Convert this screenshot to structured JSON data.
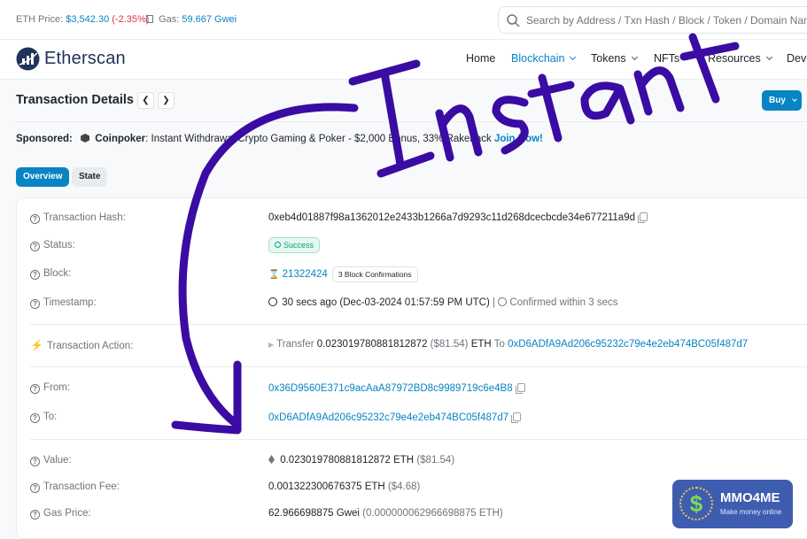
{
  "topbar": {
    "eth_price_label": "ETH Price:",
    "eth_price_value": "$3,542.30",
    "eth_price_change": "(-2.35%)",
    "gas_label": "Gas:",
    "gas_value": "59.667 Gwei",
    "search_placeholder": "Search by Address / Txn Hash / Block / Token / Domain Name"
  },
  "nav": {
    "brand": "Etherscan",
    "items": [
      {
        "label": "Home"
      },
      {
        "label": "Blockchain"
      },
      {
        "label": "Tokens"
      },
      {
        "label": "NFTs"
      },
      {
        "label": "Resources"
      },
      {
        "label": "Deve"
      }
    ]
  },
  "page": {
    "title": "Transaction Details",
    "buy_label": "Buy"
  },
  "sponsored": {
    "label": "Sponsored:",
    "brand": "Coinpoker",
    "text": ": Instant Withdrawal Crypto Gaming & Poker - $2,000 Bonus, 33% Rakeback",
    "cta": "Join Now!"
  },
  "tabs": [
    {
      "label": "Overview"
    },
    {
      "label": "State"
    }
  ],
  "details": {
    "tx_hash": {
      "label": "Transaction Hash:",
      "value": "0xeb4d01887f98a1362012e2433b1266a7d9293c11d268dcecbcde34e677211a9d"
    },
    "status": {
      "label": "Status:",
      "value": "Success"
    },
    "block": {
      "label": "Block:",
      "value": "21322424",
      "confirmations": "3 Block Confirmations"
    },
    "timestamp": {
      "label": "Timestamp:",
      "value": "30 secs ago (Dec-03-2024 01:57:59 PM UTC)",
      "separator": "|",
      "confirmed": "Confirmed within 3 secs"
    },
    "action": {
      "label": "Transaction Action:",
      "verb": "Transfer",
      "amount": "0.023019780881812872",
      "usd": "($81.54)",
      "unit": "ETH",
      "to_word": "To",
      "to_address": "0xD6ADfA9Ad206c95232c79e4e2eb474BC05f487d7"
    },
    "from": {
      "label": "From:",
      "value": "0x36D9560E371c9acAaA87972BD8c9989719c6e4B8"
    },
    "to": {
      "label": "To:",
      "value": "0xD6ADfA9Ad206c95232c79e4e2eb474BC05f487d7"
    },
    "value": {
      "label": "Value:",
      "amount": "0.023019780881812872 ETH",
      "usd": "($81.54)"
    },
    "fee": {
      "label": "Transaction Fee:",
      "amount": "0.001322300676375 ETH",
      "usd": "($4.68)"
    },
    "gas_price": {
      "label": "Gas Price:",
      "amount": "62.966698875 Gwei",
      "eth": "(0.000000062966698875 ETH)"
    }
  },
  "annotation": {
    "text": "Instant",
    "color": "#3a0ca3"
  },
  "watermark": {
    "title": "MMO4ME",
    "subtitle": "Make money online",
    "coin_symbol": "$"
  },
  "colors": {
    "accent": "#0784c3",
    "negative": "#dc3545",
    "success": "#00a186"
  }
}
